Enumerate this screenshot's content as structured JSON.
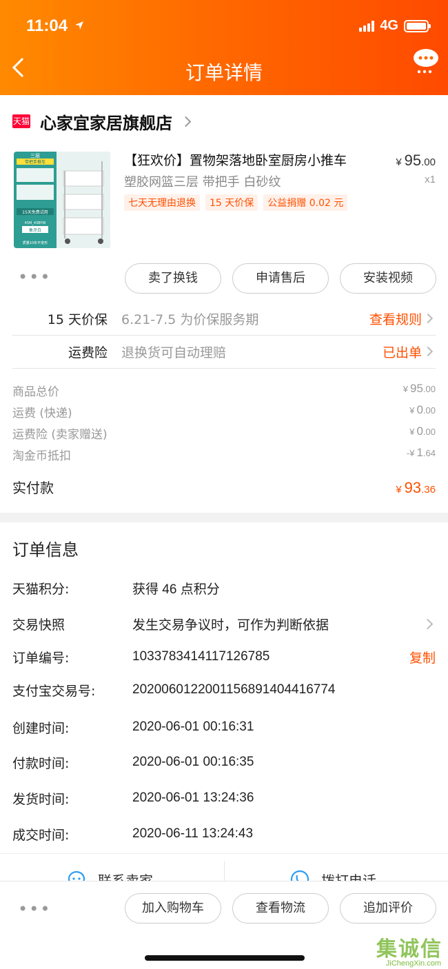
{
  "status_bar": {
    "time": "11:04",
    "network": "4G"
  },
  "header": {
    "title": "订单详情"
  },
  "store": {
    "badge": "天猫",
    "name": "心家宜家居旗舰店"
  },
  "product": {
    "title": "【狂欢价】置物架落地卧室厨房小推车",
    "subtitle": "塑胶网篮三层 带把手 白砂纹",
    "price_currency": "¥",
    "price_int": "95",
    "price_dec": ".00",
    "quantity": "x1",
    "tags": [
      "七天无理由退换",
      "15 天价保",
      "公益捐赠 0.02 元"
    ],
    "image_labels": {
      "top": "三层",
      "banner": "带把手推车",
      "trial": "15天免费试用",
      "size": "45M_43BYW",
      "color": "象牙白",
      "guarantee": "质量10年不变形"
    }
  },
  "actions_top": [
    "卖了换钱",
    "申请售后",
    "安装视频"
  ],
  "services": [
    {
      "label": "15 天价保",
      "desc": "6.21-7.5 为价保服务期",
      "link": "查看规则"
    },
    {
      "label": "运费险",
      "desc": "退换货可自动理赔",
      "link": "已出单"
    }
  ],
  "costs": [
    {
      "label": "商品总价",
      "prefix": "¥",
      "int": "95",
      "dec": ".00"
    },
    {
      "label": "运费 (快递)",
      "prefix": "¥",
      "int": "0",
      "dec": ".00"
    },
    {
      "label": "运费险 (卖家赠送)",
      "prefix": "¥",
      "int": "0",
      "dec": ".00"
    },
    {
      "label": "淘金币抵扣",
      "prefix": "-¥",
      "int": "1",
      "dec": ".64"
    }
  ],
  "paid": {
    "label": "实付款",
    "prefix": "¥",
    "int": "93",
    "dec": ".36"
  },
  "order_info": {
    "title": "订单信息",
    "rows": [
      {
        "key": "天猫积分:",
        "value": "获得 46 点积分"
      },
      {
        "key": "交易快照",
        "value": "发生交易争议时，可作为判断依据"
      },
      {
        "key": "订单编号:",
        "value": "1033783414117126785",
        "action": "复制"
      },
      {
        "key": "支付宝交易号:",
        "value": "2020060122001156891404416774"
      },
      {
        "key": "创建时间:",
        "value": "2020-06-01 00:16:31"
      },
      {
        "key": "付款时间:",
        "value": "2020-06-01 00:16:35"
      },
      {
        "key": "发货时间:",
        "value": "2020-06-01 13:24:36"
      },
      {
        "key": "成交时间:",
        "value": "2020-06-11 13:24:43"
      }
    ]
  },
  "contact": {
    "seller": "联系卖家",
    "phone": "拨打电话"
  },
  "actions_bottom": [
    "加入购物车",
    "查看物流",
    "追加评价"
  ],
  "more": "•••",
  "watermark": {
    "cn": "集诚信",
    "en": "JiChengXin.com"
  },
  "colors": {
    "accent": "#ff5000",
    "header_start": "#ff8a00",
    "header_end": "#ff4a00",
    "tmall": "#ff0036"
  }
}
